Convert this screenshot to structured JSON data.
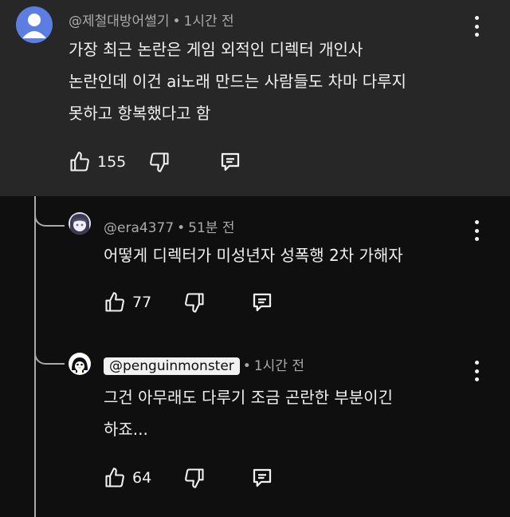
{
  "comments": [
    {
      "author": "@제철대방어썰기",
      "time": "1시간 전",
      "lines": [
        "가장 최근 논란은 게임 외적인 디렉터 개인사",
        "논란인데 이건 ai노래 만드는 사람들도 차마 다루지",
        "못하고 항복했다고 함"
      ],
      "likes": "155"
    },
    {
      "author": "@era4377",
      "time": "51분 전",
      "lines": [
        "어떻게 디렉터가 미성년자 성폭행 2차 가해자"
      ],
      "likes": "77"
    },
    {
      "author": "@penguinmonster",
      "time": "1시간 전",
      "lines": [
        "그건 아무래도 다루기 조금 곤란한 부분이긴",
        "하죠..."
      ],
      "likes": "64"
    }
  ],
  "separator": "•",
  "colors": {
    "top_bg": "#272727",
    "page_bg": "#0f0f0f",
    "meta": "#aaaaaa",
    "text": "#f1f1f1",
    "avatar_blue": "#5b7ee0"
  }
}
